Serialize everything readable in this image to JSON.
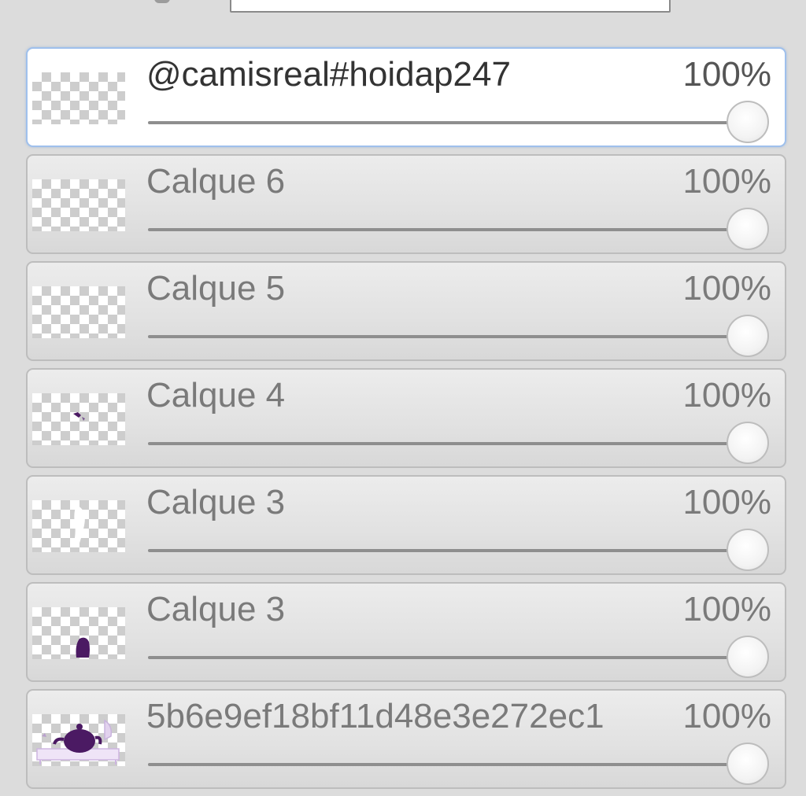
{
  "layers": [
    {
      "name": "@camisreal#hoidap247",
      "opacity": "100%",
      "opacity_value": 100,
      "selected": true,
      "thumbnail": "transparent"
    },
    {
      "name": "Calque 6",
      "opacity": "100%",
      "opacity_value": 100,
      "selected": false,
      "thumbnail": "transparent"
    },
    {
      "name": "Calque 5",
      "opacity": "100%",
      "opacity_value": 100,
      "selected": false,
      "thumbnail": "transparent-dot"
    },
    {
      "name": "Calque 4",
      "opacity": "100%",
      "opacity_value": 100,
      "selected": false,
      "thumbnail": "small-purple-mark"
    },
    {
      "name": "Calque 3",
      "opacity": "100%",
      "opacity_value": 100,
      "selected": false,
      "thumbnail": "white-shape"
    },
    {
      "name": "Calque 3",
      "opacity": "100%",
      "opacity_value": 100,
      "selected": false,
      "thumbnail": "purple-shape"
    },
    {
      "name": "5b6e9ef18bf11d48e3e272ec1",
      "opacity": "100%",
      "opacity_value": 100,
      "selected": false,
      "thumbnail": "teapot-drawing"
    }
  ],
  "colors": {
    "accent_border": "#9fc0ec",
    "thumb_purple": "#4b1a63"
  }
}
